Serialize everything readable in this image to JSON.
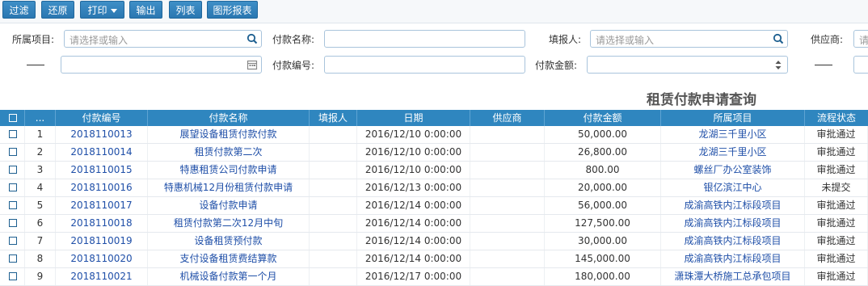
{
  "toolbar": {
    "filter": "过滤",
    "restore": "还原",
    "print": "打印",
    "export": "输出",
    "list": "列表",
    "chart_report": "图形报表"
  },
  "filters": {
    "project_label": "所属项目:",
    "project_placeholder": "请选择或输入",
    "payment_name_label": "付款名称:",
    "payment_name_value": "",
    "reporter_label": "填报人:",
    "reporter_placeholder": "请选择或输入",
    "supplier_label": "供应商:",
    "supplier_placeholder": "请",
    "payment_no_label": "付款编号:",
    "payment_no_value": "",
    "amount_label": "付款金额:",
    "amount_value": ""
  },
  "page_title": "租赁付款申请查询",
  "table": {
    "headers": {
      "index": "...",
      "code": "付款编号",
      "name": "付款名称",
      "reporter": "填报人",
      "date": "日期",
      "supplier": "供应商",
      "amount": "付款金额",
      "project": "所属项目",
      "status": "流程状态"
    },
    "rows": [
      {
        "index": "1",
        "code": "2018110013",
        "name": "展望设备租赁付款付款",
        "reporter": "",
        "date": "2016/12/10 0:00:00",
        "supplier": "",
        "amount": "50,000.00",
        "project": "龙湖三千里小区",
        "status": "审批通过"
      },
      {
        "index": "2",
        "code": "2018110014",
        "name": "租赁付款第二次",
        "reporter": "",
        "date": "2016/12/10 0:00:00",
        "supplier": "",
        "amount": "26,800.00",
        "project": "龙湖三千里小区",
        "status": "审批通过"
      },
      {
        "index": "3",
        "code": "2018110015",
        "name": "特惠租赁公司付款申请",
        "reporter": "",
        "date": "2016/12/10 0:00:00",
        "supplier": "",
        "amount": "800.00",
        "project": "螺丝厂办公室装饰",
        "status": "审批通过"
      },
      {
        "index": "4",
        "code": "2018110016",
        "name": "特惠机械12月份租赁付款申请",
        "reporter": "",
        "date": "2016/12/13 0:00:00",
        "supplier": "",
        "amount": "20,000.00",
        "project": "银亿滨江中心",
        "status": "未提交"
      },
      {
        "index": "5",
        "code": "2018110017",
        "name": "设备付款申请",
        "reporter": "",
        "date": "2016/12/14 0:00:00",
        "supplier": "",
        "amount": "56,000.00",
        "project": "成渝高铁内江标段项目",
        "status": "审批通过"
      },
      {
        "index": "6",
        "code": "2018110018",
        "name": "租赁付款第二次12月中旬",
        "reporter": "",
        "date": "2016/12/14 0:00:00",
        "supplier": "",
        "amount": "127,500.00",
        "project": "成渝高铁内江标段项目",
        "status": "审批通过"
      },
      {
        "index": "7",
        "code": "2018110019",
        "name": "设备租赁预付款",
        "reporter": "",
        "date": "2016/12/14 0:00:00",
        "supplier": "",
        "amount": "30,000.00",
        "project": "成渝高铁内江标段项目",
        "status": "审批通过"
      },
      {
        "index": "8",
        "code": "2018110020",
        "name": "支付设备租赁费结算款",
        "reporter": "",
        "date": "2016/12/14 0:00:00",
        "supplier": "",
        "amount": "145,000.00",
        "project": "成渝高铁内江标段项目",
        "status": "审批通过"
      },
      {
        "index": "9",
        "code": "2018110021",
        "name": "机械设备付款第一个月",
        "reporter": "",
        "date": "2016/12/17 0:00:00",
        "supplier": "",
        "amount": "180,000.00",
        "project": "潇珠潭大桥施工总承包项目",
        "status": "审批通过"
      }
    ]
  },
  "colors": {
    "accent": "#2f86bf",
    "link": "#1f4fa8"
  }
}
